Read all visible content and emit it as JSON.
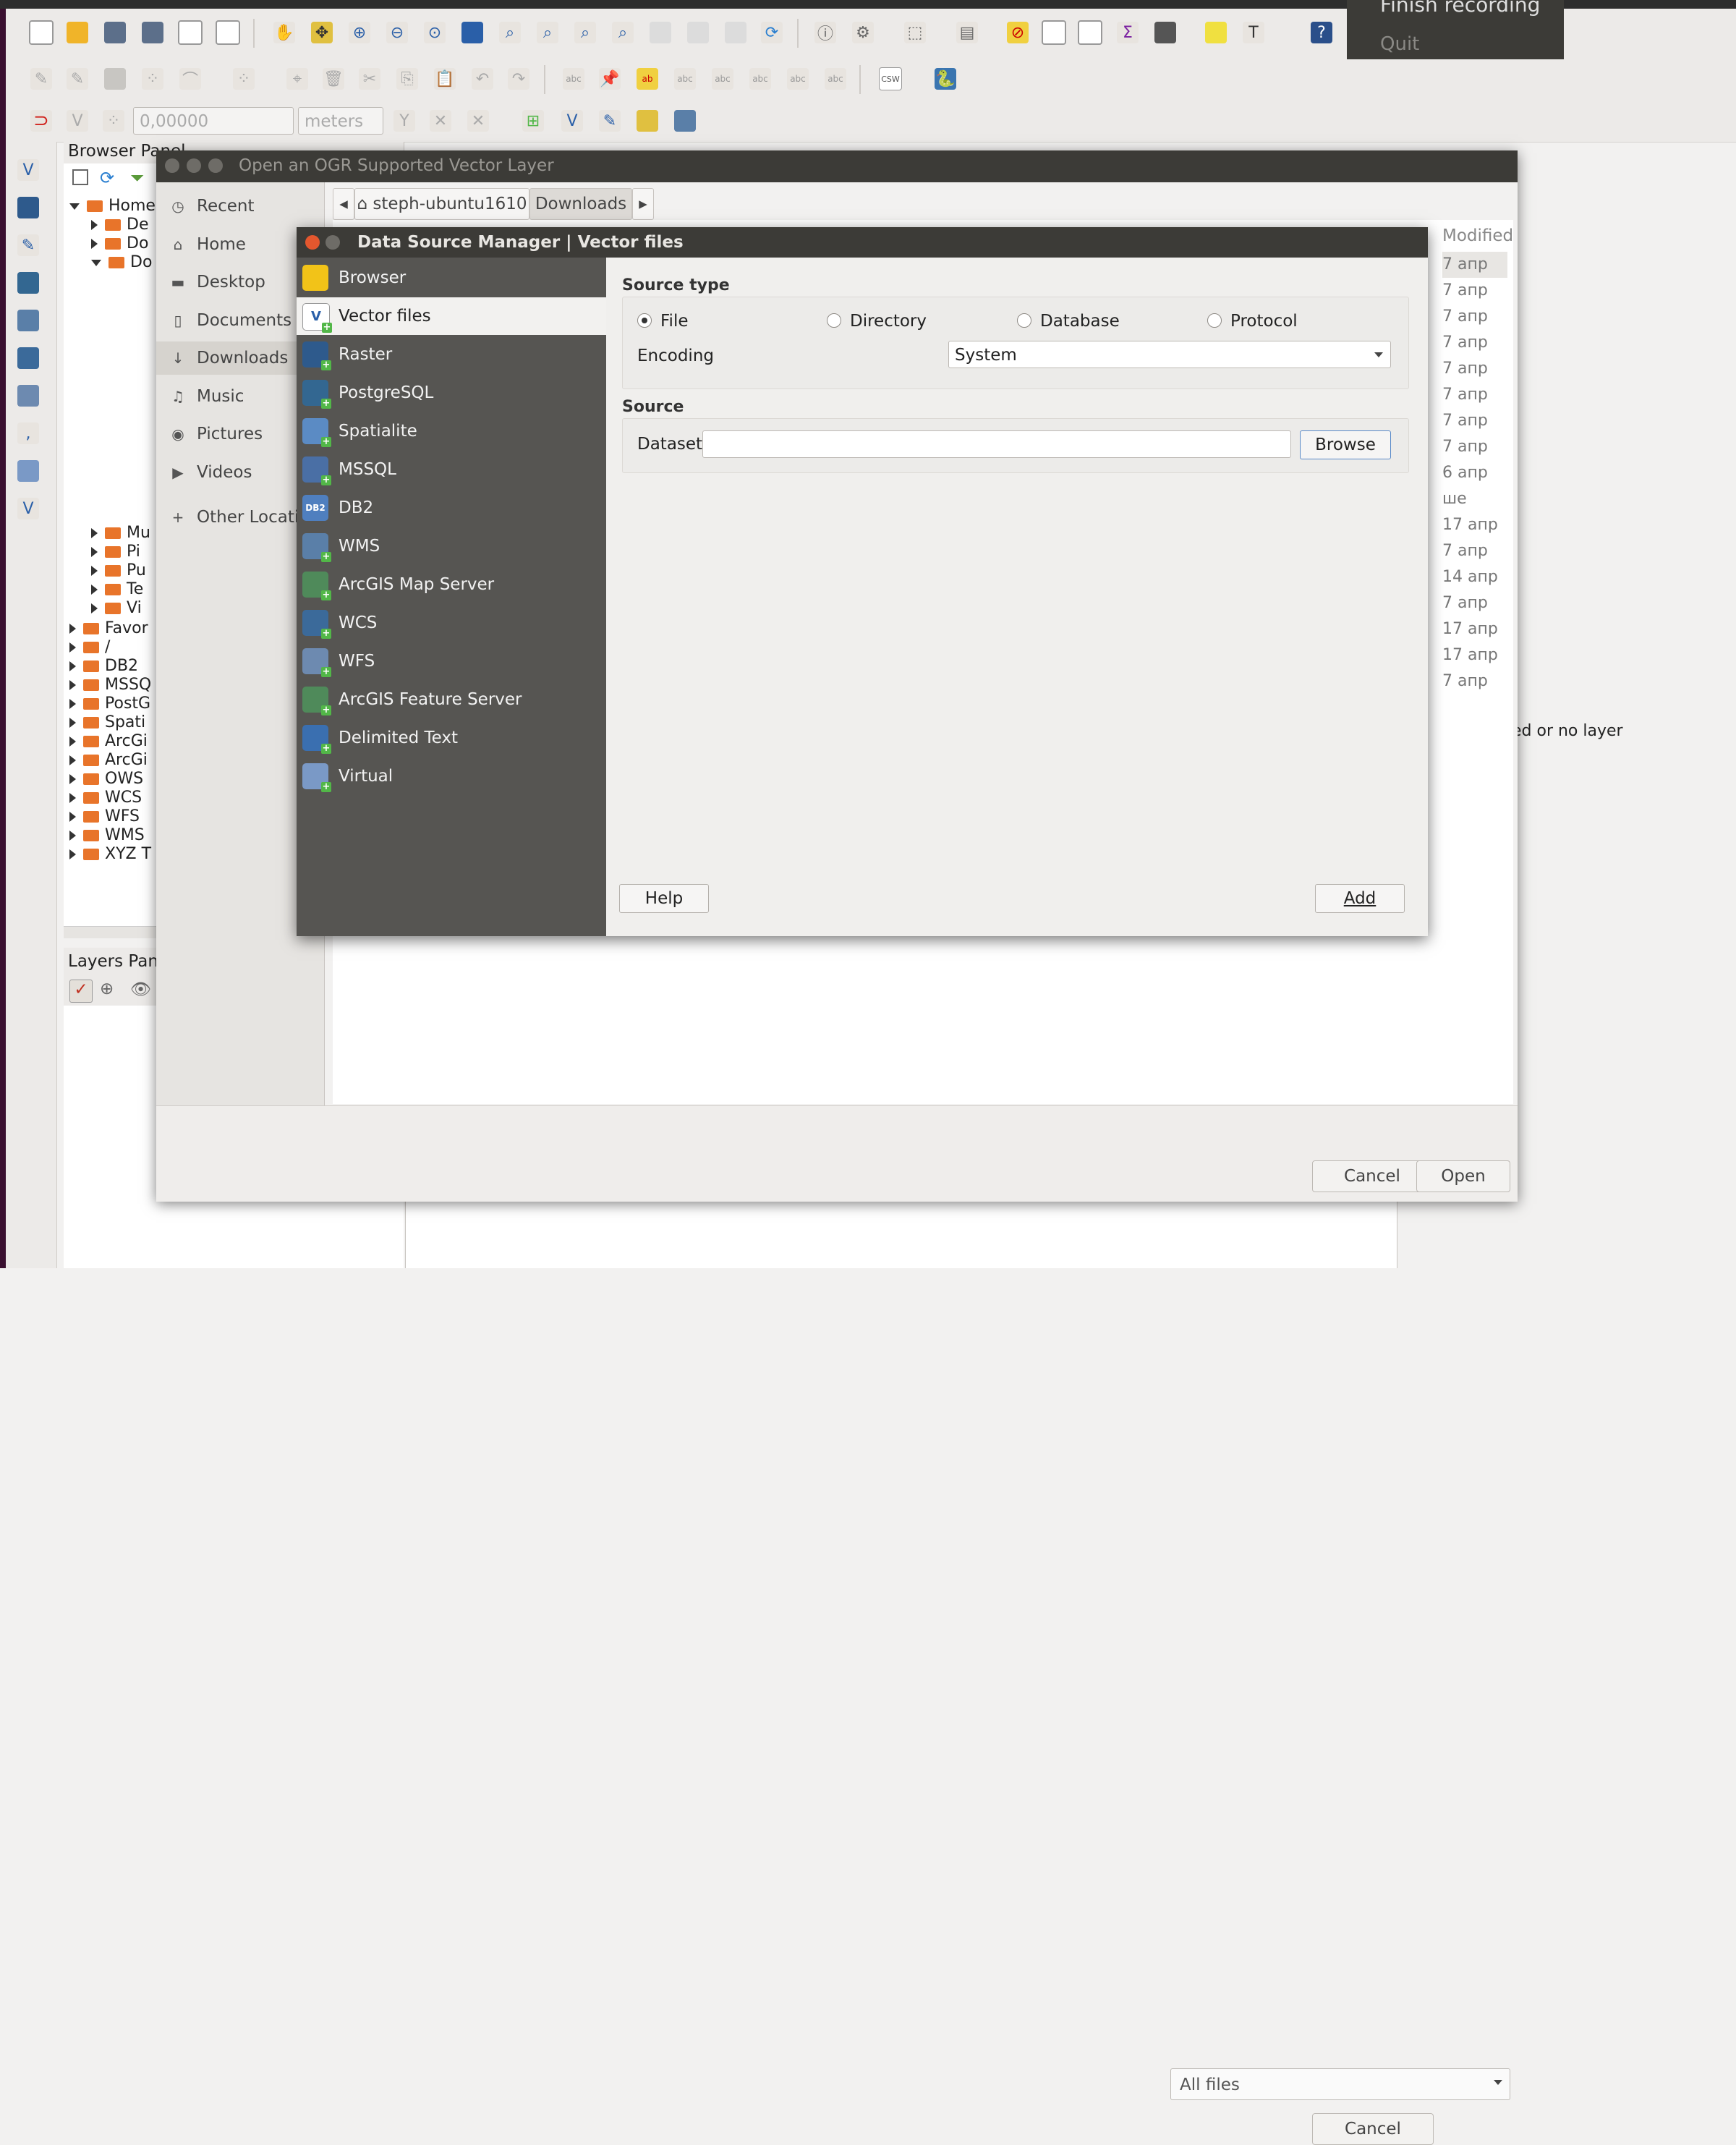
{
  "recording_menu": {
    "finish": "Finish recording",
    "quit": "Quit"
  },
  "toolbar3": {
    "snap_value": "0,00000",
    "units": "meters"
  },
  "browser_panel": {
    "title": "Browser Panel",
    "tree": [
      {
        "label": "Home",
        "indent": 0,
        "expanded": true
      },
      {
        "label": "De",
        "indent": 1
      },
      {
        "label": "Do",
        "indent": 1
      },
      {
        "label": "Do",
        "indent": 1,
        "expanded": true
      },
      {
        "label": "Mu",
        "indent": 1
      },
      {
        "label": "Pi",
        "indent": 1
      },
      {
        "label": "Pu",
        "indent": 1
      },
      {
        "label": "Te",
        "indent": 1
      },
      {
        "label": "Vi",
        "indent": 1
      },
      {
        "label": "Favor",
        "indent": 0
      },
      {
        "label": "/",
        "indent": 0
      },
      {
        "label": "DB2",
        "indent": 0
      },
      {
        "label": "MSSQ",
        "indent": 0
      },
      {
        "label": "PostG",
        "indent": 0
      },
      {
        "label": "Spati",
        "indent": 0
      },
      {
        "label": "ArcGi",
        "indent": 0
      },
      {
        "label": "ArcGi",
        "indent": 0
      },
      {
        "label": "OWS",
        "indent": 0
      },
      {
        "label": "WCS",
        "indent": 0
      },
      {
        "label": "WFS",
        "indent": 0
      },
      {
        "label": "WMS",
        "indent": 0
      },
      {
        "label": "XYZ T",
        "indent": 0
      }
    ]
  },
  "layers_panel": {
    "title": "Layers Pane"
  },
  "gtk_dialog": {
    "title": "Open an OGR Supported Vector Layer",
    "sidebar": [
      "Recent",
      "Home",
      "Desktop",
      "Documents",
      "Downloads",
      "Music",
      "Pictures",
      "Videos"
    ],
    "other_locations": "Other Locati",
    "breadcrumb": {
      "home": "steph-ubuntu1610",
      "current": "Downloads"
    },
    "modified_header": "Modified",
    "modified": [
      "7 апр",
      "7 апр",
      "7 апр",
      "7 апр",
      "7 апр",
      "7 апр",
      "7 апр",
      "7 апр",
      "6 апр",
      "ше",
      "17 апр",
      "7 апр",
      "14 апр",
      "7 апр",
      "17 апр",
      "17 апр",
      "7 апр"
    ],
    "filter": "All files",
    "cancel": "Cancel",
    "open": "Open"
  },
  "behind_text": "ed or no layer",
  "dsm": {
    "title": "Data Source Manager | Vector files",
    "items": [
      {
        "label": "Browser",
        "icon": "folder-icon",
        "color": "#f2c318"
      },
      {
        "label": "Vector files",
        "icon": "vector-icon",
        "color": "#ffffff"
      },
      {
        "label": "Raster",
        "icon": "raster-icon",
        "color": "#2e5a8c"
      },
      {
        "label": "PostgreSQL",
        "icon": "elephant-icon",
        "color": "#336791"
      },
      {
        "label": "Spatialite",
        "icon": "feather-icon",
        "color": "#5b8bc4"
      },
      {
        "label": "MSSQL",
        "icon": "mssql-icon",
        "color": "#4a6fa5"
      },
      {
        "label": "DB2",
        "icon": "db2-icon",
        "color": "#4f7fbf"
      },
      {
        "label": "WMS",
        "icon": "globe-icon",
        "color": "#5a7fa8"
      },
      {
        "label": "ArcGIS Map Server",
        "icon": "arcgis-globe-icon",
        "color": "#4f8a5a"
      },
      {
        "label": "WCS",
        "icon": "globe-icon",
        "color": "#3b6a9a"
      },
      {
        "label": "WFS",
        "icon": "globe-icon",
        "color": "#6d8ab0"
      },
      {
        "label": "ArcGIS Feature Server",
        "icon": "arcgis-globe-icon",
        "color": "#4f8a5a"
      },
      {
        "label": "Delimited Text",
        "icon": "comma-icon",
        "color": "#3a6fb0"
      },
      {
        "label": "Virtual",
        "icon": "virtual-icon",
        "color": "#7a99c6"
      }
    ],
    "source_type_title": "Source type",
    "radios": [
      {
        "label": "File",
        "checked": true
      },
      {
        "label": "Directory",
        "checked": false
      },
      {
        "label": "Database",
        "checked": false
      },
      {
        "label": "Protocol",
        "checked": false
      }
    ],
    "encoding_label": "Encoding",
    "encoding_value": "System",
    "source_title": "Source",
    "dataset_label": "Dataset",
    "dataset_value": "",
    "browse": "Browse",
    "help": "Help",
    "add": "Add"
  }
}
